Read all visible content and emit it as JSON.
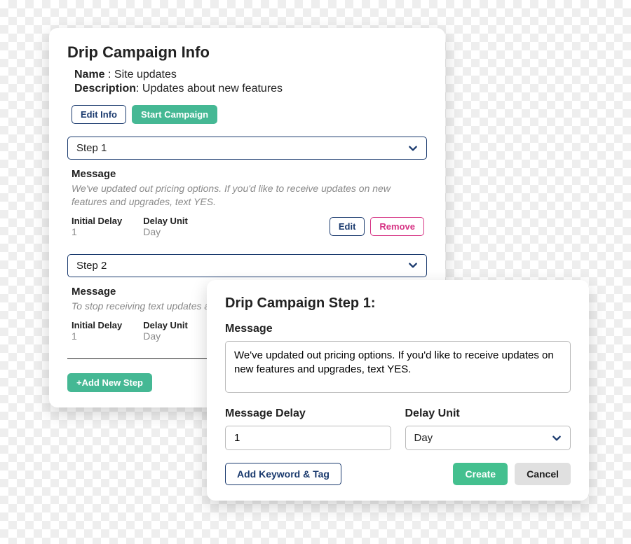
{
  "card1": {
    "title": "Drip Campaign Info",
    "name_label": "Name",
    "name_value": "Site updates",
    "desc_label": "Description",
    "desc_value": "Updates about new features",
    "edit_info": "Edit Info",
    "start_campaign": "Start Campaign",
    "steps": [
      {
        "header": "Step 1",
        "msg_label": "Message",
        "msg": "We've updated out pricing options. If you'd like to receive updates on new features and upgrades, text YES.",
        "initial_delay_label": "Initial Delay",
        "initial_delay": "1",
        "delay_unit_label": "Delay Unit",
        "delay_unit": "Day",
        "edit": "Edit",
        "remove": "Remove"
      },
      {
        "header": "Step 2",
        "msg_label": "Message",
        "msg": "To stop receiving text updates a",
        "initial_delay_label": "Initial Delay",
        "initial_delay": "1",
        "delay_unit_label": "Delay Unit",
        "delay_unit": "Day"
      }
    ],
    "add_new_step": "+Add New Step"
  },
  "card2": {
    "title": "Drip Campaign Step 1:",
    "message_label": "Message",
    "message_value": "We've updated out pricing options. If you'd like to receive updates on new features and upgrades, text YES.",
    "delay_label": "Message Delay",
    "delay_value": "1",
    "unit_label": "Delay Unit",
    "unit_value": "Day",
    "add_keyword": "Add Keyword & Tag",
    "create": "Create",
    "cancel": "Cancel"
  }
}
